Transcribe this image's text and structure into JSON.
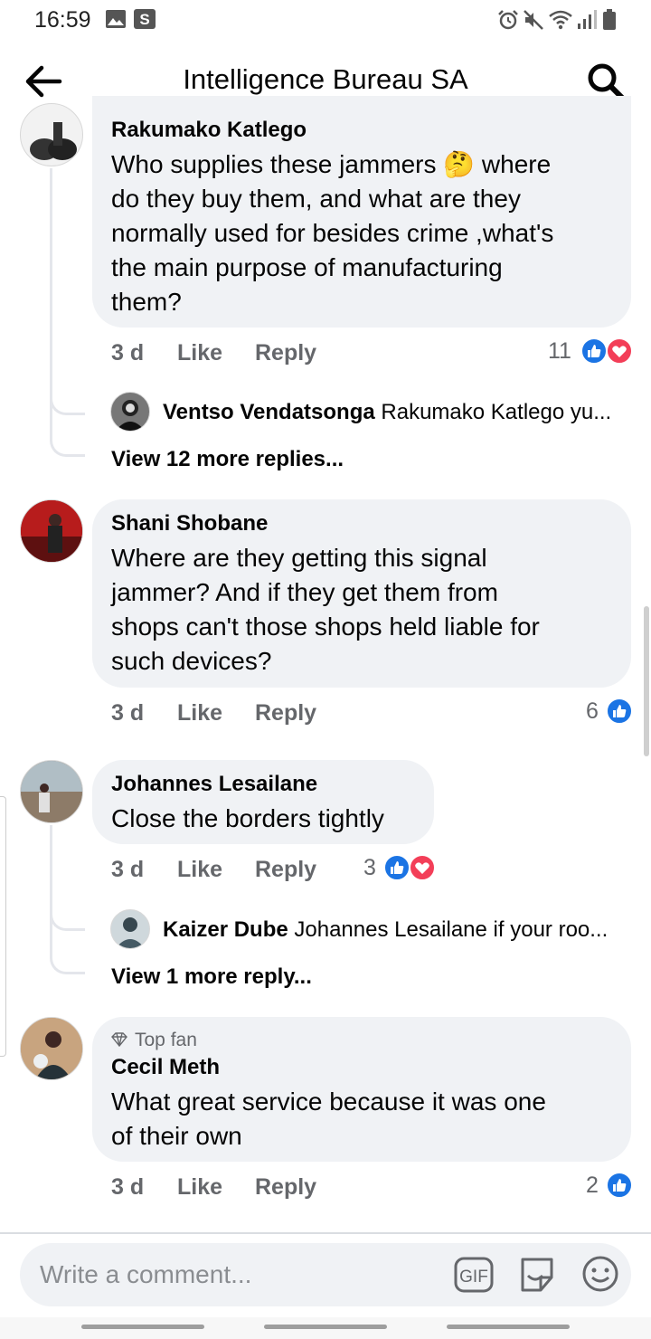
{
  "status_bar": {
    "time": "16:59"
  },
  "header": {
    "title": "Intelligence Bureau SA"
  },
  "comments": [
    {
      "author": "Rakumako Katlego",
      "lines": [
        "Who supplies these jammers 🤔 where",
        "do they buy them, and what are they",
        "normally used for besides crime ,what's",
        "the main purpose of manufacturing",
        "them?"
      ],
      "time": "3 d",
      "like_label": "Like",
      "reply_label": "Reply",
      "reaction_count": "11",
      "reply_preview": {
        "author": "Ventso Vendatsonga",
        "text": "Rakumako Katlego yu..."
      },
      "view_more": "View 12 more replies..."
    },
    {
      "author": "Shani Shobane",
      "lines": [
        "Where are they getting this signal",
        "jammer? And if they get them from",
        "shops can't those shops held liable for",
        "such devices?"
      ],
      "time": "3 d",
      "like_label": "Like",
      "reply_label": "Reply",
      "reaction_count": "6"
    },
    {
      "author": "Johannes Lesailane",
      "lines": [
        "Close the borders tightly"
      ],
      "time": "3 d",
      "like_label": "Like",
      "reply_label": "Reply",
      "reaction_count": "3",
      "reply_preview": {
        "author": "Kaizer Dube",
        "text": "Johannes Lesailane if your roo..."
      },
      "view_more": "View 1 more reply..."
    },
    {
      "badge": "Top fan",
      "author": "Cecil Meth",
      "lines": [
        "What great service because  it was one",
        "of their own"
      ],
      "time": "3 d",
      "like_label": "Like",
      "reply_label": "Reply",
      "reaction_count": "2"
    }
  ],
  "composer": {
    "placeholder": "Write a comment...",
    "gif_label": "GIF"
  },
  "colors": {
    "like": "#1b74e4",
    "love": "#f33e58",
    "bubble": "#f0f2f5",
    "meta": "#65676b"
  },
  "icons": [
    "back-arrow-icon",
    "search-icon",
    "thumbs-up-icon",
    "heart-icon",
    "gif-icon",
    "sticker-icon",
    "emoji-icon",
    "diamond-icon"
  ]
}
